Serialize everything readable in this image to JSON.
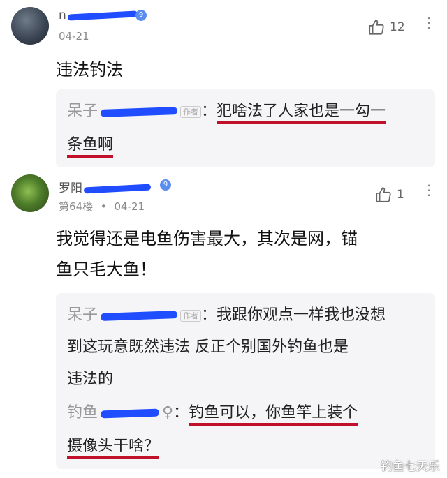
{
  "comment1": {
    "username_prefix": "n",
    "level": "9",
    "date": "04-21",
    "likes": "12",
    "text": "违法钓法",
    "reply": {
      "author_prefix": "呆子",
      "author_tag": "作者",
      "separator": "：",
      "text_line1": "犯啥法了人家也是一勾一",
      "text_line2": "条鱼啊"
    }
  },
  "comment2": {
    "username_prefix": "罗阳",
    "level": "9",
    "floor": "第64楼",
    "dot": "•",
    "date": "04-21",
    "likes": "1",
    "text_line1": "我觉得还是电鱼伤害最大，其次是网，锚",
    "text_line2": "鱼只毛大鱼！",
    "replies": [
      {
        "author_prefix": "呆子",
        "author_tag": "作者",
        "separator": "：",
        "text_line1": "我跟你观点一样我也没想",
        "text_line2": "到这玩意既然违法 反正个别国外钓鱼也是",
        "text_line3": "违法的"
      },
      {
        "author_prefix": "钓鱼",
        "author_suffix": "♀",
        "separator": "：",
        "text_line1": "钓鱼可以，你鱼竿上装个",
        "text_line2": "摄像头干啥？"
      }
    ]
  },
  "watermark": "钓鱼七天乐",
  "icons": {
    "like": "thumbs-up-icon",
    "more": "more-vertical-icon"
  }
}
